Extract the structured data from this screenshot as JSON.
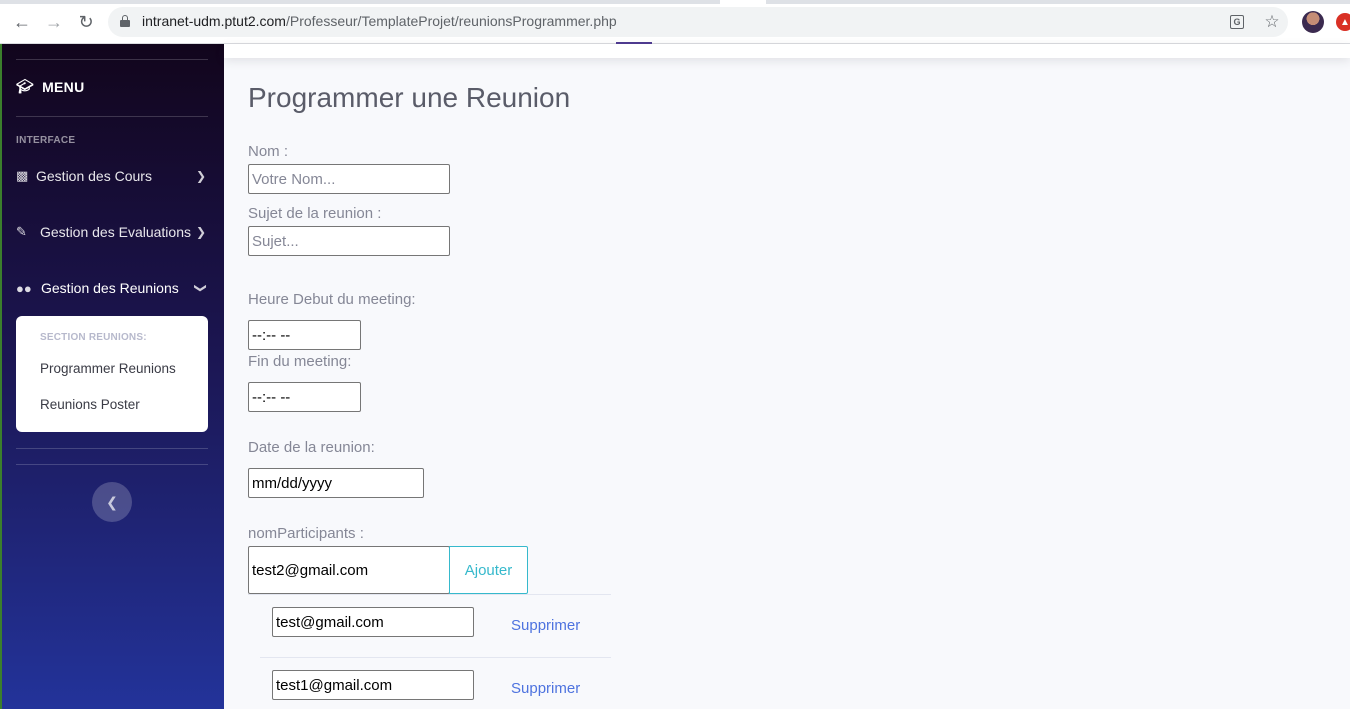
{
  "browser": {
    "url_domain": "intranet-udm.ptut2.com",
    "url_path": "/Professeur/TemplateProjet/reunionsProgrammer.php"
  },
  "sidebar": {
    "brand": "MENU",
    "heading": "INTERFACE",
    "items": [
      {
        "label": "Gestion des Cours",
        "icon": "book-icon"
      },
      {
        "label": "Gestion des Evaluations",
        "icon": "edit-icon"
      },
      {
        "label": "Gestion des Reunions",
        "icon": "users-icon"
      }
    ],
    "submenu": {
      "heading": "SECTION REUNIONS:",
      "links": [
        "Programmer Reunions",
        "Reunions Poster"
      ]
    }
  },
  "main": {
    "title": "Programmer une Reunion",
    "nom_label": "Nom :",
    "nom_placeholder": "Votre Nom...",
    "sujet_label": "Sujet de la reunion :",
    "sujet_placeholder": "Sujet...",
    "debut_label": "Heure Debut du meeting:",
    "debut_value": "--:-- --",
    "fin_label": "Fin du meeting:",
    "fin_value": "--:-- --",
    "date_label": "Date de la reunion:",
    "date_value": "mm/dd/yyyy",
    "participants_label": "nomParticipants :",
    "participant_input": "test2@gmail.com",
    "add_label": "Ajouter",
    "participants": [
      {
        "email": "test@gmail.com",
        "delete_label": "Supprimer"
      },
      {
        "email": "test1@gmail.com",
        "delete_label": "Supprimer"
      }
    ]
  },
  "colors": {
    "accent_info": "#36b9cc",
    "link_primary": "#4e73df",
    "sidebar_top": "#12051c",
    "sidebar_bottom": "#23339a"
  }
}
